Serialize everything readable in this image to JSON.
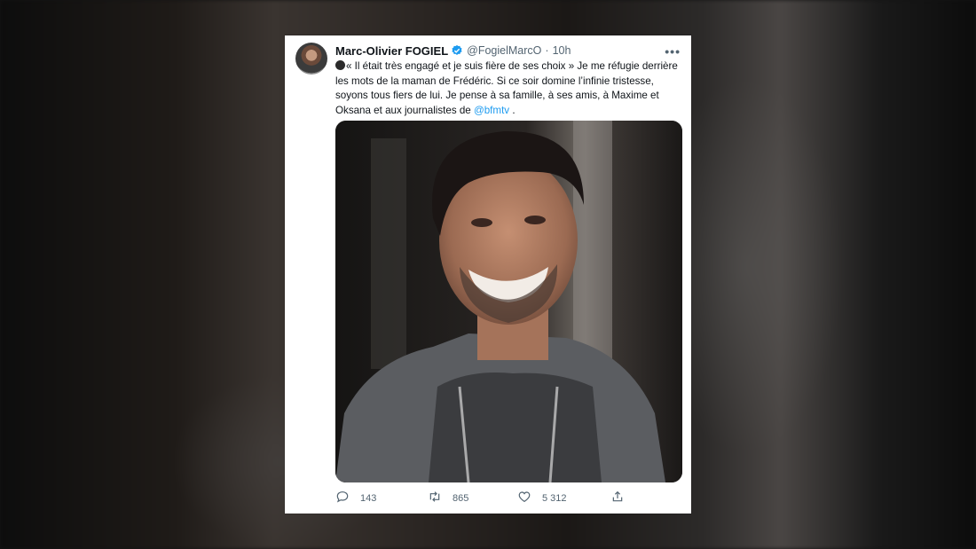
{
  "tweet": {
    "display_name": "Marc-Olivier FOGIEL",
    "handle": "@FogielMarcO",
    "separator": "·",
    "time": "10h",
    "more_icon": "ellipsis-icon",
    "text_main": "« Il était très engagé et je suis fière de ses choix » Je me réfugie derrière les mots de la maman de Frédéric. Si ce soir domine l’infinie tristesse, soyons tous fiers de lui. Je pense à sa famille, à ses amis, à Maxime et Oksana et aux journalistes de ",
    "mention": "@bfmtv",
    "text_end": " .",
    "replies": "143",
    "retweets": "865",
    "likes": "5 312"
  },
  "colors": {
    "accent": "#1d9bf0",
    "text": "#0f1419",
    "muted": "#536471"
  }
}
